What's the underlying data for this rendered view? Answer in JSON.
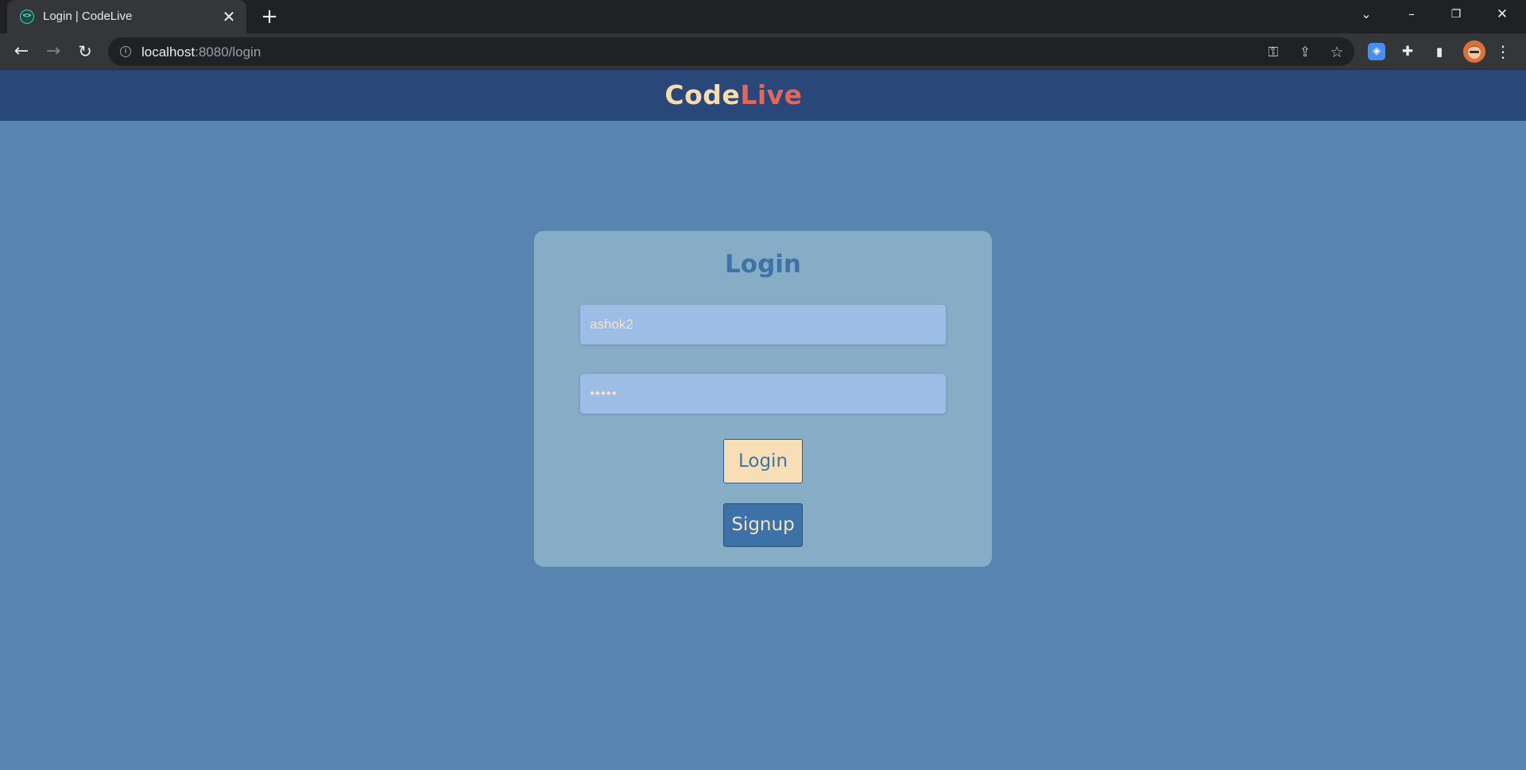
{
  "browser": {
    "tab": {
      "favicon": "codelive-favicon",
      "title": "Login | CodeLive",
      "close_glyph": "✕"
    },
    "new_tab_glyph": "+",
    "window_controls": {
      "tab_search_glyph": "⌄",
      "minimize_glyph": "–",
      "restore_glyph": "❐",
      "close_glyph": "✕"
    },
    "nav": {
      "back_glyph": "←",
      "forward_glyph": "→",
      "reload_glyph": "↻"
    },
    "address": {
      "host": "localhost",
      "rest": ":8080/login",
      "info_glyph": "i"
    },
    "omnibox_icons": {
      "key_glyph": "⚿",
      "share_glyph": "⇪",
      "star_glyph": "☆"
    },
    "extensions": {
      "shield_glyph": "◈",
      "puzzle_glyph": "✚",
      "sidepanel_glyph": "▮",
      "menu_glyph": "⋮"
    }
  },
  "site": {
    "brand_part1": "Code",
    "brand_part2": "Live"
  },
  "login_form": {
    "title": "Login",
    "username_value": "ashok2",
    "password_masked": "•••••",
    "login_button": "Login",
    "signup_button": "Signup"
  },
  "colors": {
    "page_bg": "#5784b0",
    "header_bg": "#294778",
    "card_bg": "#87acc6",
    "accent_cream": "#f7deb6",
    "accent_red": "#e0685e",
    "accent_blue": "#3f73a7"
  }
}
